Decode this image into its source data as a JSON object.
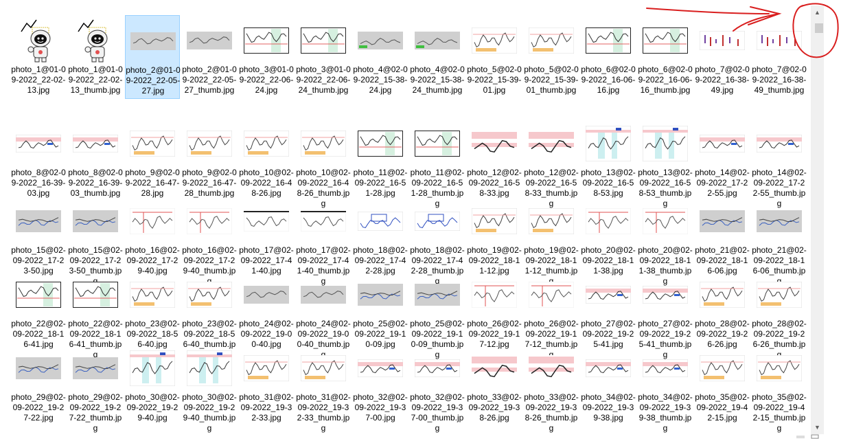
{
  "files": [
    {
      "label": "photo_1@01-09-2022_22-02-13.jpg",
      "kind": "robot"
    },
    {
      "label": "photo_1@01-09-2022_22-02-13_thumb.jpg",
      "kind": "robot"
    },
    {
      "label": "photo_2@01-09-2022_22-05-27.jpg",
      "kind": "gray-chart",
      "selected": true
    },
    {
      "label": "photo_2@01-09-2022_22-05-27_thumb.jpg",
      "kind": "gray-chart"
    },
    {
      "label": "photo_3@01-09-2022_22-06-24.jpg",
      "kind": "dark-chart"
    },
    {
      "label": "photo_3@01-09-2022_22-06-24_thumb.jpg",
      "kind": "dark-chart"
    },
    {
      "label": "photo_4@02-09-2022_15-38-24.jpg",
      "kind": "gray-green"
    },
    {
      "label": "photo_4@02-09-2022_15-38-24_thumb.jpg",
      "kind": "gray-green"
    },
    {
      "label": "photo_5@02-09-2022_15-39-01.jpg",
      "kind": "light-chart"
    },
    {
      "label": "photo_5@02-09-2022_15-39-01_thumb.jpg",
      "kind": "light-chart"
    },
    {
      "label": "photo_6@02-09-2022_16-06-16.jpg",
      "kind": "dark-chart"
    },
    {
      "label": "photo_6@02-09-2022_16-06-16_thumb.jpg",
      "kind": "dark-chart"
    },
    {
      "label": "photo_7@02-09-2022_16-38-49.jpg",
      "kind": "candle-chart"
    },
    {
      "label": "photo_7@02-09-2022_16-38-49_thumb.jpg",
      "kind": "candle-chart"
    },
    {
      "label": "photo_8@02-09-2022_16-39-03.jpg",
      "kind": "pink-chart"
    },
    {
      "label": "photo_8@02-09-2022_16-39-03_thumb.jpg",
      "kind": "pink-chart"
    },
    {
      "label": "photo_9@02-09-2022_16-47-28.jpg",
      "kind": "light-chart"
    },
    {
      "label": "photo_9@02-09-2022_16-47-28_thumb.jpg",
      "kind": "light-chart"
    },
    {
      "label": "photo_10@02-09-2022_16-48-26.jpg",
      "kind": "light-chart"
    },
    {
      "label": "photo_10@02-09-2022_16-48-26_thumb.jpg",
      "kind": "light-chart"
    },
    {
      "label": "photo_11@02-09-2022_16-51-28.jpg",
      "kind": "dark-chart"
    },
    {
      "label": "photo_11@02-09-2022_16-51-28_thumb.jpg",
      "kind": "dark-chart"
    },
    {
      "label": "photo_12@02-09-2022_16-58-33.jpg",
      "kind": "pink-band"
    },
    {
      "label": "photo_12@02-09-2022_16-58-33_thumb.jpg",
      "kind": "pink-band"
    },
    {
      "label": "photo_13@02-09-2022_16-58-53.jpg",
      "kind": "teal-chart"
    },
    {
      "label": "photo_13@02-09-2022_16-58-53_thumb.jpg",
      "kind": "teal-chart"
    },
    {
      "label": "photo_14@02-09-2022_17-22-55.jpg",
      "kind": "pink-chart"
    },
    {
      "label": "photo_14@02-09-2022_17-22-55_thumb.jpg",
      "kind": "pink-chart"
    },
    {
      "label": "photo_15@02-09-2022_17-23-50.jpg",
      "kind": "gray-blue"
    },
    {
      "label": "photo_15@02-09-2022_17-23-50_thumb.jpg",
      "kind": "gray-blue"
    },
    {
      "label": "photo_16@02-09-2022_17-29-40.jpg",
      "kind": "red-lines"
    },
    {
      "label": "photo_16@02-09-2022_17-29-40_thumb.jpg",
      "kind": "red-lines"
    },
    {
      "label": "photo_17@02-09-2022_17-41-40.jpg",
      "kind": "top-bar"
    },
    {
      "label": "photo_17@02-09-2022_17-41-40_thumb.jpg",
      "kind": "top-bar"
    },
    {
      "label": "photo_18@02-09-2022_17-42-28.jpg",
      "kind": "blue-box"
    },
    {
      "label": "photo_18@02-09-2022_17-42-28_thumb.jpg",
      "kind": "blue-box"
    },
    {
      "label": "photo_19@02-09-2022_18-11-12.jpg",
      "kind": "light-chart"
    },
    {
      "label": "photo_19@02-09-2022_18-11-12_thumb.jpg",
      "kind": "light-chart"
    },
    {
      "label": "photo_20@02-09-2022_18-11-38.jpg",
      "kind": "red-lines"
    },
    {
      "label": "photo_20@02-09-2022_18-11-38_thumb.jpg",
      "kind": "red-lines"
    },
    {
      "label": "photo_21@02-09-2022_18-16-06.jpg",
      "kind": "gray-blue"
    },
    {
      "label": "photo_21@02-09-2022_18-16-06_thumb.jpg",
      "kind": "gray-blue"
    },
    {
      "label": "photo_22@02-09-2022_18-16-41.jpg",
      "kind": "dark-chart"
    },
    {
      "label": "photo_22@02-09-2022_18-16-41_thumb.jpg",
      "kind": "dark-chart"
    },
    {
      "label": "photo_23@02-09-2022_18-56-40.jpg",
      "kind": "light-chart"
    },
    {
      "label": "photo_23@02-09-2022_18-56-40_thumb.jpg",
      "kind": "light-chart"
    },
    {
      "label": "photo_24@02-09-2022_19-00-40.jpg",
      "kind": "gray-chart"
    },
    {
      "label": "photo_24@02-09-2022_19-00-40_thumb.jpg",
      "kind": "gray-chart"
    },
    {
      "label": "photo_25@02-09-2022_19-10-09.jpg",
      "kind": "gray-blue"
    },
    {
      "label": "photo_25@02-09-2022_19-10-09_thumb.jpg",
      "kind": "gray-blue"
    },
    {
      "label": "photo_26@02-09-2022_19-17-12.jpg",
      "kind": "red-lines"
    },
    {
      "label": "photo_26@02-09-2022_19-17-12_thumb.jpg",
      "kind": "red-lines"
    },
    {
      "label": "photo_27@02-09-2022_19-25-41.jpg",
      "kind": "pink-chart"
    },
    {
      "label": "photo_27@02-09-2022_19-25-41_thumb.jpg",
      "kind": "pink-chart"
    },
    {
      "label": "photo_28@02-09-2022_19-26-26.jpg",
      "kind": "light-chart"
    },
    {
      "label": "photo_28@02-09-2022_19-26-26_thumb.jpg",
      "kind": "light-chart"
    },
    {
      "label": "photo_29@02-09-2022_19-27-22.jpg",
      "kind": "gray-blue"
    },
    {
      "label": "photo_29@02-09-2022_19-27-22_thumb.jpg",
      "kind": "gray-blue"
    },
    {
      "label": "photo_30@02-09-2022_19-29-40.jpg",
      "kind": "teal-chart"
    },
    {
      "label": "photo_30@02-09-2022_19-29-40_thumb.jpg",
      "kind": "teal-chart"
    },
    {
      "label": "photo_31@02-09-2022_19-32-33.jpg",
      "kind": "light-chart"
    },
    {
      "label": "photo_31@02-09-2022_19-32-33_thumb.jpg",
      "kind": "light-chart"
    },
    {
      "label": "photo_32@02-09-2022_19-37-00.jpg",
      "kind": "pink-chart"
    },
    {
      "label": "photo_32@02-09-2022_19-37-00_thumb.jpg",
      "kind": "pink-chart"
    },
    {
      "label": "photo_33@02-09-2022_19-38-26.jpg",
      "kind": "pink-band"
    },
    {
      "label": "photo_33@02-09-2022_19-38-26_thumb.jpg",
      "kind": "pink-band"
    },
    {
      "label": "photo_34@02-09-2022_19-39-38.jpg",
      "kind": "pink-chart"
    },
    {
      "label": "photo_34@02-09-2022_19-39-38_thumb.jpg",
      "kind": "pink-chart"
    },
    {
      "label": "photo_35@02-09-2022_19-42-15.jpg",
      "kind": "light-chart"
    },
    {
      "label": "photo_35@02-09-2022_19-42-15_thumb.jpg",
      "kind": "light-chart"
    }
  ],
  "scrollbar": {
    "up_icon": "chevron-up-icon",
    "down_icon": "chevron-down-icon",
    "up_glyph": "▲",
    "down_glyph": "▼"
  },
  "annotation": {
    "color": "#d91e1e"
  },
  "colors": {
    "selection_bg": "#cce8ff",
    "selection_border": "#99d1ff"
  }
}
